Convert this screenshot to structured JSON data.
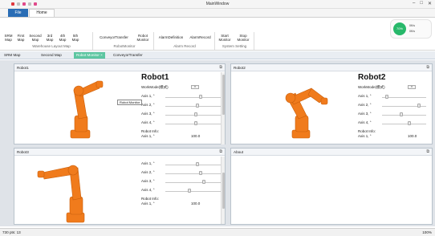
{
  "window": {
    "title": "MainWindow"
  },
  "quick_access": {
    "colors": [
      "#e0393e",
      "#c0c0c0",
      "#e04a8a",
      "#c0c0c0",
      "#e04a8a"
    ]
  },
  "tabs": {
    "file": "File",
    "home": "Home"
  },
  "ribbon": {
    "buttons": [
      {
        "id": "srm-map",
        "label": "SRM\nMap"
      },
      {
        "id": "first-map",
        "label": "First\nMap"
      },
      {
        "id": "second-map",
        "label": "Second\nMap"
      },
      {
        "id": "third-map",
        "label": "3rd\nMap"
      },
      {
        "id": "fourth-map",
        "label": "4th\nMap"
      },
      {
        "id": "fifth-map",
        "label": "5th\nMap"
      },
      {
        "id": "conveyor-transfer",
        "label": "ConveyorTransfer"
      },
      {
        "id": "robot-monitor",
        "label": "Robot\nMonitor"
      },
      {
        "id": "alarm-definition",
        "label": "AlarmDefinition"
      },
      {
        "id": "alarm-record",
        "label": "AlarmRecord"
      },
      {
        "id": "start-monitor",
        "label": "Start\nMonitor"
      },
      {
        "id": "stop-monitor",
        "label": "Stop\nMonitor"
      }
    ],
    "groups": [
      "Warehouse Layout Map",
      "RobotMonitor",
      "Alarm Record",
      "System Setting"
    ]
  },
  "gauge": {
    "value": "70%",
    "rate1": "0K/s",
    "rate2": "0K/s"
  },
  "doc_tabs": [
    "SRM Map",
    "Second Map",
    "Robot Monitor",
    "ConveyorTransfer"
  ],
  "active_doc_tab": "Robot Monitor",
  "close_glyph": "×",
  "panels": [
    {
      "header": "Robot1",
      "title": "Robot1",
      "mode_label": "WorkMode(模式)",
      "axes": [
        "Axis 1, °",
        "Axis 2, °",
        "Axis 3, °",
        "Axis 4, °"
      ],
      "info": "Robot Info:",
      "info_axis": "Axis 1, °",
      "info_value": "100.0"
    },
    {
      "header": "Robot2",
      "title": "Robot2",
      "mode_label": "WorkMode(模式)",
      "axes": [
        "Axis 1, °",
        "Axis 2, °",
        "Axis 3, °",
        "Axis 4, °"
      ],
      "info": "Robot Info:",
      "info_axis": "Axis 1, °",
      "info_value": "100.0"
    },
    {
      "header": "Robot3",
      "axes": [
        "Axis 1, °",
        "Axis 2, °",
        "Axis 3, °",
        "Axis 4, °"
      ],
      "info": "Robot Info:",
      "info_axis": "Axis 1, °",
      "info_value": "100.0"
    },
    {
      "header": "About"
    }
  ],
  "tooltip": "Robot Monitor",
  "status": {
    "left": "730 pts: 13",
    "right": "100%"
  },
  "colors": {
    "robot": "#f07b1c",
    "accent": "#2a6db5",
    "active_tab": "#5cc6a1",
    "gauge": "#27b86a"
  }
}
